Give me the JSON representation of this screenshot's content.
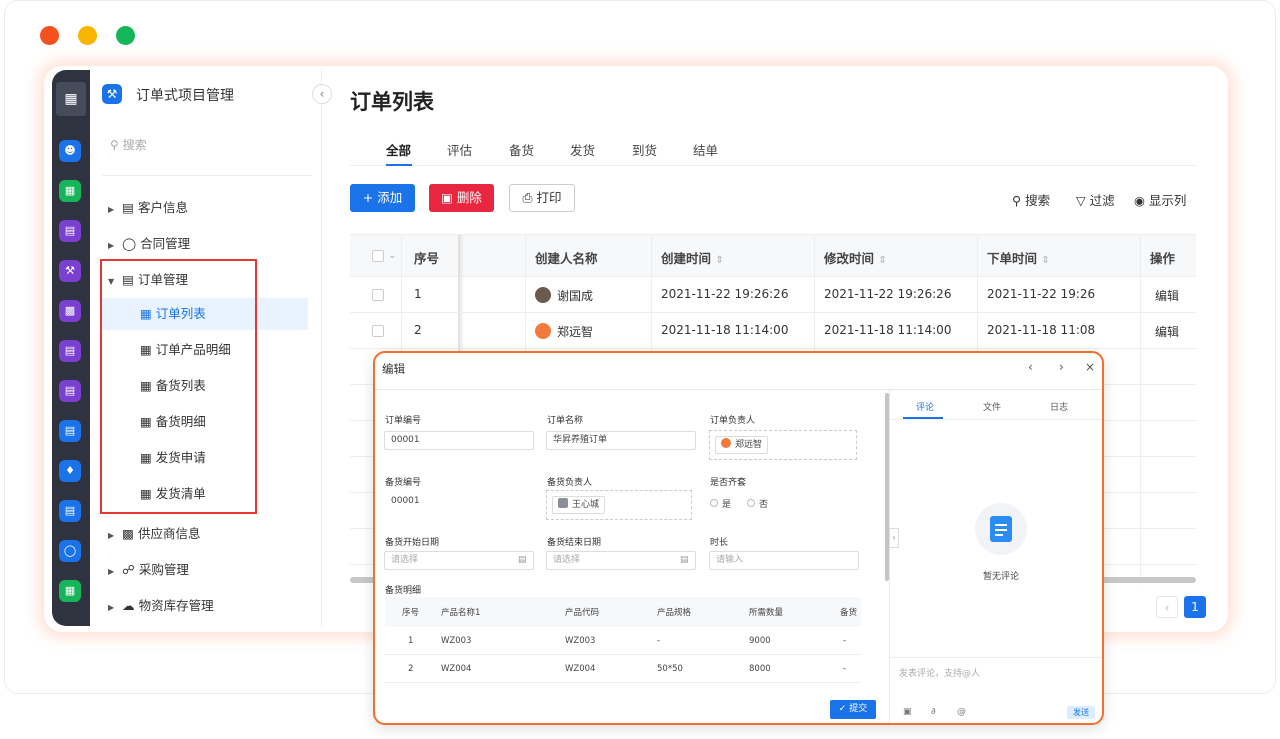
{
  "window": {
    "dots": [
      "#f5511e",
      "#f9b400",
      "#15b65a"
    ]
  },
  "rail_icons": [
    {
      "icon": "grid-icon",
      "color": "#464b5a"
    },
    {
      "icon": "contacts-icon",
      "color": "#1a73e8"
    },
    {
      "icon": "spreadsheet-icon",
      "color": "#15b65a"
    },
    {
      "icon": "clipboard-icon",
      "color": "#7b3fd1"
    },
    {
      "icon": "wrench-icon",
      "color": "#7b3fd1"
    },
    {
      "icon": "truck-icon",
      "color": "#7b3fd1"
    },
    {
      "icon": "building-icon",
      "color": "#7b3fd1"
    },
    {
      "icon": "document-icon",
      "color": "#7b3fd1"
    },
    {
      "icon": "inbox-icon",
      "color": "#1a73e8"
    },
    {
      "icon": "handshake-icon",
      "color": "#1a73e8"
    },
    {
      "icon": "form-icon",
      "color": "#1a73e8"
    },
    {
      "icon": "shield-icon",
      "color": "#1a73e8"
    },
    {
      "icon": "table-icon",
      "color": "#15b65a"
    }
  ],
  "nav": {
    "app_title": "订单式项目管理",
    "search_placeholder": "搜索",
    "groups": [
      {
        "label": "客户信息"
      },
      {
        "label": "合同管理"
      },
      {
        "label": "订单管理"
      }
    ],
    "subitems": [
      {
        "label": "订单列表",
        "active": true
      },
      {
        "label": "订单产品明细"
      },
      {
        "label": "备货列表"
      },
      {
        "label": "备货明细"
      },
      {
        "label": "发货申请"
      },
      {
        "label": "发货清单"
      }
    ],
    "groups_after": [
      {
        "label": "供应商信息"
      },
      {
        "label": "采购管理"
      },
      {
        "label": "物资库存管理"
      }
    ]
  },
  "main": {
    "title": "订单列表",
    "tabs": [
      "全部",
      "评估",
      "备货",
      "发货",
      "到货",
      "结单"
    ],
    "buttons": {
      "add": "添加",
      "delete": "删除",
      "print": "打印"
    },
    "tools": {
      "search": "搜索",
      "filter": "过滤",
      "columns": "显示列"
    },
    "table": {
      "headers": [
        "序号",
        "创建人名称",
        "创建时间",
        "修改时间",
        "下单时间",
        "操作"
      ],
      "rows": [
        {
          "no": "1",
          "creator": "谢国成",
          "created": "2021-11-22 19:26:26",
          "modified": "2021-11-22 19:26:26",
          "ordered": "2021-11-22 19:26",
          "action": "编辑"
        },
        {
          "no": "2",
          "creator": "郑远智",
          "created": "2021-11-18 11:14:00",
          "modified": "2021-11-18 11:14:00",
          "ordered": "2021-11-18 11:08",
          "action": "编辑"
        }
      ]
    },
    "pager": {
      "current": "1"
    }
  },
  "modal": {
    "title": "编辑",
    "fields": {
      "order_no_label": "订单编号",
      "order_no_value": "00001",
      "order_name_label": "订单名称",
      "order_name_value": "华昇养殖订单",
      "order_owner_label": "订单负责人",
      "order_owner_value": "郑远智",
      "stock_no_label": "备货编号",
      "stock_no_value": "00001",
      "stock_owner_label": "备货负责人",
      "stock_owner_value": "王心城",
      "complete_label": "是否齐套",
      "radio_yes": "是",
      "radio_no": "否",
      "start_label": "备货开始日期",
      "start_placeholder": "请选择",
      "end_label": "备货结束日期",
      "end_placeholder": "请选择",
      "duration_label": "时长",
      "duration_placeholder": "请输入",
      "detail_label": "备货明细"
    },
    "detail_table": {
      "headers": [
        "序号",
        "产品名称1",
        "产品代码",
        "产品规格",
        "所需数量",
        "备货"
      ],
      "rows": [
        [
          "1",
          "WZ003",
          "WZ003",
          "-",
          "9000",
          "-"
        ],
        [
          "2",
          "WZ004",
          "WZ004",
          "50*50",
          "8000",
          "-"
        ]
      ]
    },
    "submit": "提交",
    "side_tabs": [
      "评论",
      "文件",
      "日志"
    ],
    "empty_text": "暂无评论",
    "comment_placeholder": "发表评论，支持@人",
    "send": "发送"
  }
}
